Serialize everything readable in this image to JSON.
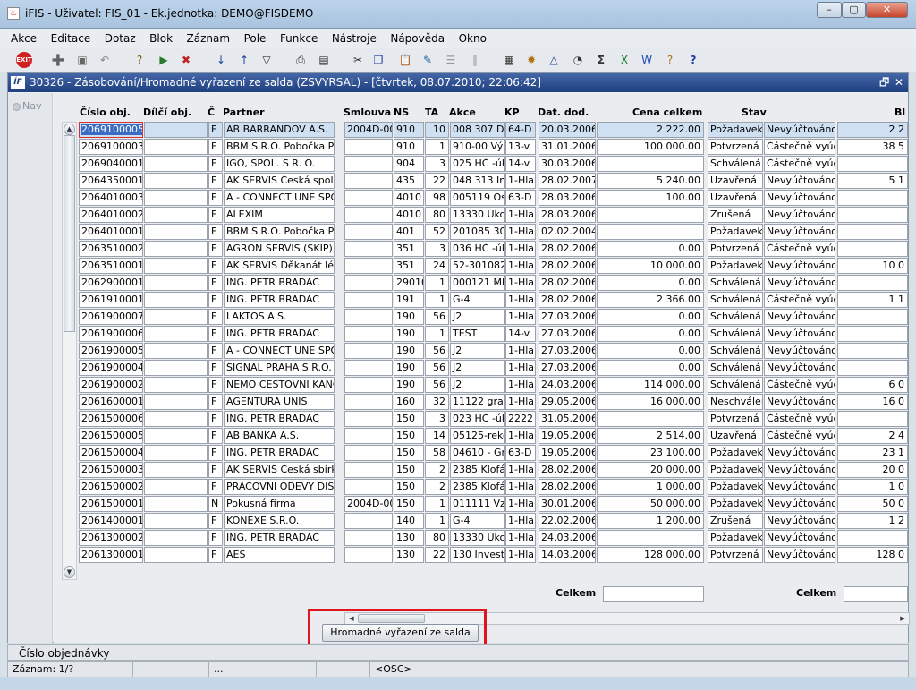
{
  "window": {
    "title": "iFIS - Uživatel: FIS_01 - Ek.jednotka: DEMO@FISDEMO",
    "minimize": "–",
    "maximize": "▢",
    "close": "✕"
  },
  "menu": [
    "Akce",
    "Editace",
    "Dotaz",
    "Blok",
    "Záznam",
    "Pole",
    "Funkce",
    "Nástroje",
    "Nápověda",
    "Okno"
  ],
  "toolbar_icons": [
    "exit-icon",
    "insert-record-icon",
    "save-icon",
    "undo-icon",
    "enter-query-icon",
    "execute-query-icon",
    "cancel-query-icon",
    "sort-asc-icon",
    "sort-desc-icon",
    "filter-icon",
    "print-icon",
    "print-preview-icon",
    "cut-icon",
    "copy-icon",
    "paste-icon",
    "edit-icon",
    "list-icon",
    "columns-icon",
    "calculator-icon",
    "settings-icon",
    "export-icon",
    "chart-icon",
    "sum-icon",
    "excel-icon",
    "word-icon",
    "help-icon",
    "question-icon"
  ],
  "inner_window": {
    "logo": "ÍF",
    "title": "30326 - Zásobování/Hromadné vyřazení ze salda (ZSVYRSAL) - [čtvrtek, 08.07.2010; 22:06:42]",
    "restore": "🗗",
    "close": "✕"
  },
  "nav_label": "Nav",
  "columns": [
    "Číslo obj.",
    "Dílčí obj.",
    "Č",
    "Partner",
    "Smlouva",
    "NS",
    "TA",
    "Akce",
    "KP",
    "Dat. dod.",
    "Cena celkem",
    "Stav",
    "Bl"
  ],
  "rows": [
    {
      "cislo": "2069100005",
      "dilci": "",
      "c": "F",
      "partner": "AB BARRANDOV A.S.",
      "smlouva": "2004D-00",
      "ns": "910",
      "ta": "10",
      "akce": "008 307 DČ-",
      "kp": "64-D",
      "dat": "20.03.2006",
      "cena": "2 222.00",
      "stav": "Požadavek",
      "stav2": "Nevyúčtováno",
      "bl": "2 2"
    },
    {
      "cislo": "2069100003",
      "dilci": "",
      "c": "F",
      "partner": "BBM S.R.O. Pobočka Prah",
      "smlouva": "",
      "ns": "910",
      "ta": "1",
      "akce": "910-00 Výuk",
      "kp": "13-v",
      "dat": "31.01.2006",
      "cena": "100 000.00",
      "stav": "Potvrzená",
      "stav2": "Částečně vyúčt",
      "bl": "38 5"
    },
    {
      "cislo": "2069040001",
      "dilci": "",
      "c": "F",
      "partner": "IGO, SPOL. S R. O.",
      "smlouva": "",
      "ns": "904",
      "ta": "3",
      "akce": "025 HČ -úko",
      "kp": "14-v",
      "dat": "30.03.2006",
      "cena": "",
      "stav": "Schválená",
      "stav2": "Částečně vyúčt",
      "bl": ""
    },
    {
      "cislo": "2064350001",
      "dilci": "",
      "c": "F",
      "partner": "AK SERVIS Česká společ",
      "smlouva": "",
      "ns": "435",
      "ta": "22",
      "akce": "048 313 Inve",
      "kp": "1-Hla",
      "dat": "28.02.2007",
      "cena": "5 240.00",
      "stav": "Uzavřená",
      "stav2": "Nevyúčtováno",
      "bl": "5 1"
    },
    {
      "cislo": "2064010003",
      "dilci": "",
      "c": "F",
      "partner": "A - CONNECT UNE SPOL",
      "smlouva": "",
      "ns": "4010",
      "ta": "98",
      "akce": "005119 Ostr",
      "kp": "63-D",
      "dat": "28.03.2006",
      "cena": "100.00",
      "stav": "Uzavřená",
      "stav2": "Nevyúčtováno",
      "bl": ""
    },
    {
      "cislo": "2064010002",
      "dilci": "",
      "c": "F",
      "partner": "ALEXIM",
      "smlouva": "",
      "ns": "4010",
      "ta": "80",
      "akce": "13330 Úkol 2",
      "kp": "1-Hla",
      "dat": "28.03.2006",
      "cena": "",
      "stav": "Zrušená",
      "stav2": "Nevyúčtováno",
      "bl": ""
    },
    {
      "cislo": "2064010001",
      "dilci": "",
      "c": "F",
      "partner": "BBM S.R.O. Pobočka Prah",
      "smlouva": "",
      "ns": "401",
      "ta": "52",
      "akce": "201085 304.",
      "kp": "1-Hla",
      "dat": "02.02.2004",
      "cena": "",
      "stav": "Požadavek",
      "stav2": "Nevyúčtováno",
      "bl": ""
    },
    {
      "cislo": "2063510002",
      "dilci": "",
      "c": "F",
      "partner": "AGRON SERVIS (SKIP)",
      "smlouva": "",
      "ns": "351",
      "ta": "3",
      "akce": "036 HČ -úko",
      "kp": "1-Hla",
      "dat": "28.02.2006",
      "cena": "0.00",
      "stav": "Potvrzená",
      "stav2": "Částečně vyúčt",
      "bl": ""
    },
    {
      "cislo": "2063510001",
      "dilci": "",
      "c": "F",
      "partner": "AK SERVIS Děkanát lékař",
      "smlouva": "",
      "ns": "351",
      "ta": "24",
      "akce": "52-301082 l",
      "kp": "1-Hla",
      "dat": "28.02.2006",
      "cena": "10 000.00",
      "stav": "Požadavek",
      "stav2": "Nevyúčtováno",
      "bl": "10 0"
    },
    {
      "cislo": "2062900001",
      "dilci": "",
      "c": "F",
      "partner": "ING. PETR BRADAC",
      "smlouva": "",
      "ns": "29010",
      "ta": "1",
      "akce": "000121 MK",
      "kp": "1-Hla",
      "dat": "28.02.2006",
      "cena": "0.00",
      "stav": "Schválená",
      "stav2": "Nevyúčtováno",
      "bl": ""
    },
    {
      "cislo": "2061910001",
      "dilci": "",
      "c": "F",
      "partner": "ING. PETR BRADAC",
      "smlouva": "",
      "ns": "191",
      "ta": "1",
      "akce": "G-4",
      "kp": "1-Hla",
      "dat": "28.02.2006",
      "cena": "2 366.00",
      "stav": "Schválená",
      "stav2": "Částečně vyúčt",
      "bl": "1 1"
    },
    {
      "cislo": "2061900007",
      "dilci": "",
      "c": "F",
      "partner": "LAKTOS A.S.",
      "smlouva": "",
      "ns": "190",
      "ta": "56",
      "akce": "J2",
      "kp": "1-Hla",
      "dat": "27.03.2006",
      "cena": "0.00",
      "stav": "Schválená",
      "stav2": "Nevyúčtováno",
      "bl": ""
    },
    {
      "cislo": "2061900006",
      "dilci": "",
      "c": "F",
      "partner": "ING. PETR BRADAC",
      "smlouva": "",
      "ns": "190",
      "ta": "1",
      "akce": "TEST",
      "kp": "14-v",
      "dat": "27.03.2006",
      "cena": "0.00",
      "stav": "Schválená",
      "stav2": "Nevyúčtováno",
      "bl": ""
    },
    {
      "cislo": "2061900005",
      "dilci": "",
      "c": "F",
      "partner": "A - CONNECT UNE SPOL",
      "smlouva": "",
      "ns": "190",
      "ta": "56",
      "akce": "J2",
      "kp": "1-Hla",
      "dat": "27.03.2006",
      "cena": "0.00",
      "stav": "Schválená",
      "stav2": "Nevyúčtováno",
      "bl": ""
    },
    {
      "cislo": "2061900004",
      "dilci": "",
      "c": "F",
      "partner": "SIGNAL PRAHA S.R.O.",
      "smlouva": "",
      "ns": "190",
      "ta": "56",
      "akce": "J2",
      "kp": "1-Hla",
      "dat": "27.03.2006",
      "cena": "0.00",
      "stav": "Schválená",
      "stav2": "Nevyúčtováno",
      "bl": ""
    },
    {
      "cislo": "2061900002",
      "dilci": "",
      "c": "F",
      "partner": "NEMO CESTOVNI KANCE",
      "smlouva": "",
      "ns": "190",
      "ta": "56",
      "akce": "J2",
      "kp": "1-Hla",
      "dat": "24.03.2006",
      "cena": "114 000.00",
      "stav": "Schválená",
      "stav2": "Částečně vyúčt",
      "bl": "6 0"
    },
    {
      "cislo": "2061600001",
      "dilci": "",
      "c": "F",
      "partner": "AGENTURA UNIS",
      "smlouva": "",
      "ns": "160",
      "ta": "32",
      "akce": "11122 grant",
      "kp": "1-Hla",
      "dat": "29.05.2006",
      "cena": "16 000.00",
      "stav": "Neschválená",
      "stav2": "Nevyúčtováno",
      "bl": "16 0"
    },
    {
      "cislo": "2061500006",
      "dilci": "",
      "c": "F",
      "partner": "ING. PETR BRADAC",
      "smlouva": "",
      "ns": "150",
      "ta": "3",
      "akce": "023 HČ -úko",
      "kp": "2222",
      "dat": "31.05.2006",
      "cena": "",
      "stav": "Potvrzená",
      "stav2": "Částečně vyúčt",
      "bl": ""
    },
    {
      "cislo": "2061500005",
      "dilci": "",
      "c": "F",
      "partner": "AB BANKA A.S.",
      "smlouva": "",
      "ns": "150",
      "ta": "14",
      "akce": "05125-rekon",
      "kp": "1-Hla",
      "dat": "19.05.2006",
      "cena": "2 514.00",
      "stav": "Uzavřená",
      "stav2": "Částečně vyúčt",
      "bl": "2 4"
    },
    {
      "cislo": "2061500004",
      "dilci": "",
      "c": "F",
      "partner": "ING. PETR BRADAC",
      "smlouva": "",
      "ns": "150",
      "ta": "58",
      "akce": "04610 - Gra",
      "kp": "63-D",
      "dat": "19.05.2006",
      "cena": "23 100.00",
      "stav": "Požadavek",
      "stav2": "Nevyúčtováno",
      "bl": "23 1"
    },
    {
      "cislo": "2061500003",
      "dilci": "",
      "c": "F",
      "partner": "AK SERVIS Česká sbírka",
      "smlouva": "",
      "ns": "150",
      "ta": "2",
      "akce": "2385 Klofáč",
      "kp": "1-Hla",
      "dat": "28.02.2006",
      "cena": "20 000.00",
      "stav": "Požadavek",
      "stav2": "Nevyúčtováno",
      "bl": "20 0"
    },
    {
      "cislo": "2061500002",
      "dilci": "",
      "c": "F",
      "partner": "PRACOVNI ODEVY DISPO",
      "smlouva": "",
      "ns": "150",
      "ta": "2",
      "akce": "2385 Klofáč",
      "kp": "1-Hla",
      "dat": "28.02.2006",
      "cena": "1 000.00",
      "stav": "Požadavek",
      "stav2": "Nevyúčtováno",
      "bl": "1 0"
    },
    {
      "cislo": "2061500001",
      "dilci": "",
      "c": "N",
      "partner": "Pokusná firma",
      "smlouva": "2004D-00",
      "ns": "150",
      "ta": "1",
      "akce": "011111 Vzd",
      "kp": "1-Hla",
      "dat": "30.01.2006",
      "cena": "50 000.00",
      "stav": "Požadavek",
      "stav2": "Nevyúčtováno",
      "bl": "50 0"
    },
    {
      "cislo": "2061400001",
      "dilci": "",
      "c": "F",
      "partner": "KONEXE S.R.O.",
      "smlouva": "",
      "ns": "140",
      "ta": "1",
      "akce": "G-4",
      "kp": "1-Hla",
      "dat": "22.02.2006",
      "cena": "1 200.00",
      "stav": "Zrušená",
      "stav2": "Nevyúčtováno",
      "bl": "1 2"
    },
    {
      "cislo": "2061300002",
      "dilci": "",
      "c": "F",
      "partner": "ING. PETR BRADAC",
      "smlouva": "",
      "ns": "130",
      "ta": "80",
      "akce": "13330 Úkol 2",
      "kp": "1-Hla",
      "dat": "24.03.2006",
      "cena": "",
      "stav": "Požadavek",
      "stav2": "Nevyúčtováno",
      "bl": ""
    },
    {
      "cislo": "2061300001",
      "dilci": "",
      "c": "F",
      "partner": "AES",
      "smlouva": "",
      "ns": "130",
      "ta": "22",
      "akce": "130 Investic",
      "kp": "1-Hla",
      "dat": "14.03.2006",
      "cena": "128 000.00",
      "stav": "Potvrzená",
      "stav2": "Nevyúčtováno",
      "bl": "128 0"
    }
  ],
  "totals": {
    "label1": "Celkem",
    "label2": "Celkem",
    "value1": "",
    "value2": ""
  },
  "action_button": "Hromadné vyřazení ze salda",
  "status": {
    "hint": "Číslo objednávky",
    "record": "Záznam: 1/?",
    "seg2": "",
    "seg3": "...",
    "seg4": "",
    "osc": "<OSC>"
  },
  "colors": {
    "highlight": "#e0141c",
    "title_active": "#1f3f7e",
    "selected_cell": "#3b6cc4"
  }
}
